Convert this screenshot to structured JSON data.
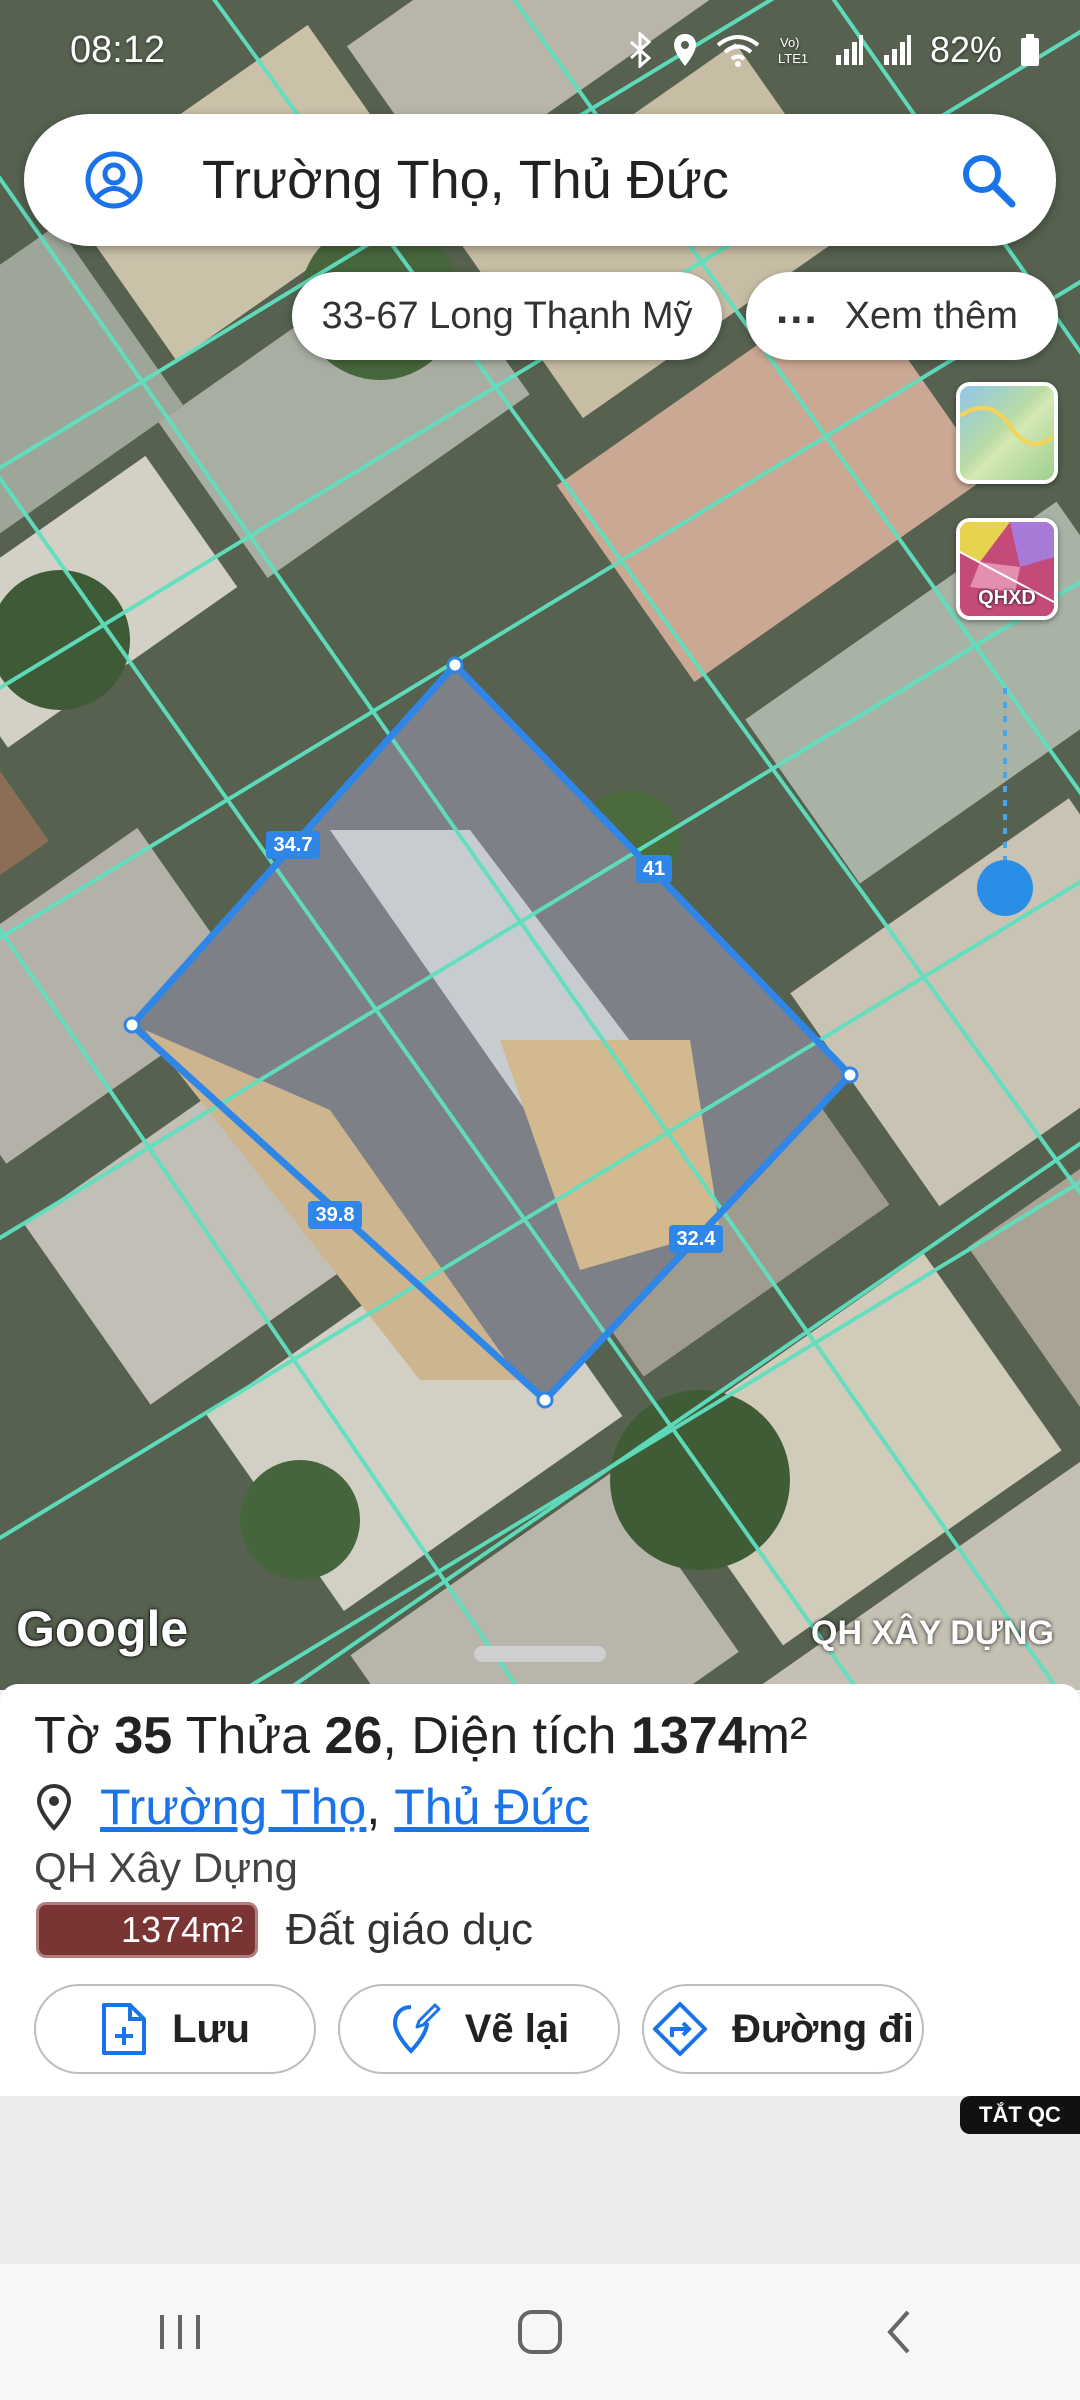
{
  "status_bar": {
    "time": "08:12",
    "battery": "82%"
  },
  "search": {
    "text": "Trường Thọ, Thủ Đức"
  },
  "chips": {
    "address": "33-67 Long Thạnh Mỹ",
    "more_dots": "...",
    "more": "Xem thêm"
  },
  "layers": {
    "qhxd": "QHXD"
  },
  "map": {
    "google": "Google",
    "layer_label": "QH XÂY DỰNG",
    "edges": [
      "34.7",
      "41",
      "39.8",
      "32.4"
    ]
  },
  "parcel": {
    "prefix_to": "Tờ ",
    "to": "35",
    "prefix_thua": " Thửa ",
    "thua": "26",
    "prefix_area": ", Diện tích ",
    "area": "1374",
    "unit": "m²",
    "ward": "Trường Thọ",
    "separator": ",",
    "district": "Thủ Đức",
    "plan_type": "QH Xây Dựng",
    "zone_area": "1374m²",
    "zone_label": "Đất giáo dục",
    "zone_color": "#7a3434"
  },
  "actions": {
    "save": "Lưu",
    "redraw": "Vẽ lại",
    "directions": "Đường đi"
  },
  "ad": {
    "off_label": "TẮT QC"
  },
  "colors": {
    "accent": "#1a73e8",
    "parcel_line": "#2f86e6",
    "boundary": "#5fe0c0"
  }
}
